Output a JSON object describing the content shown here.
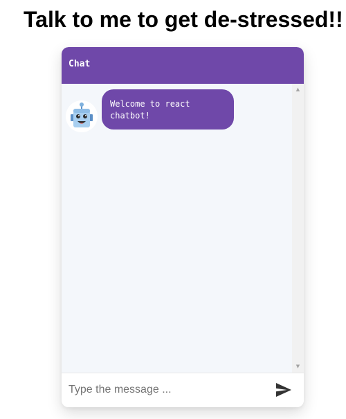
{
  "page": {
    "title": "Talk to me to get de-stressed!!"
  },
  "chatbot": {
    "header": {
      "title": "Chat",
      "background_color": "#6f48a9"
    },
    "messages": [
      {
        "sender": "bot",
        "avatar_icon": "robot-icon",
        "text": "Welcome to react chatbot!"
      }
    ],
    "input": {
      "value": "",
      "placeholder": "Type the message ..."
    },
    "send_button": {
      "icon": "send-icon"
    },
    "colors": {
      "accent": "#6f48a9",
      "message_area": "#f4f7fb"
    }
  }
}
